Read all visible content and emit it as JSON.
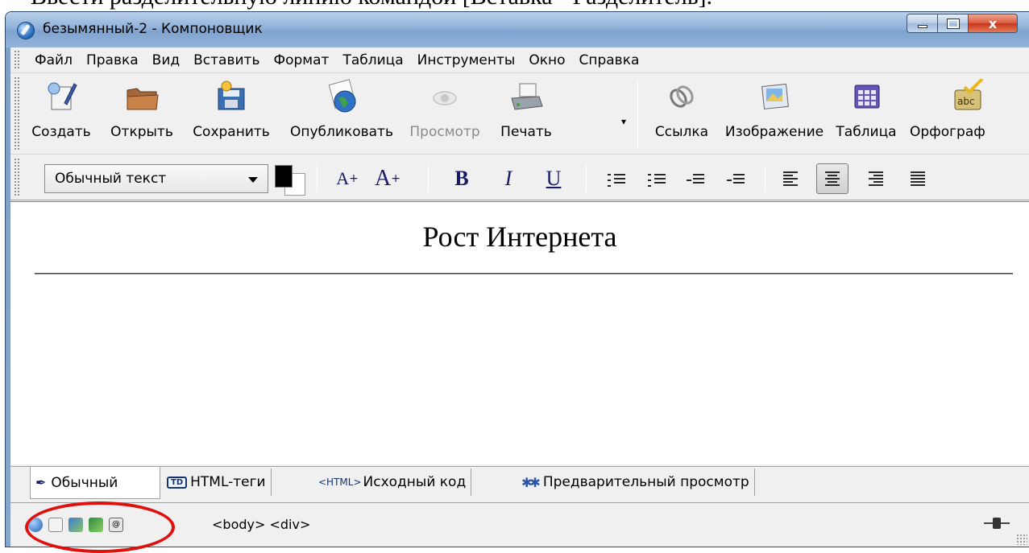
{
  "document_line": "Ввести разделительную линию командой [Вставка - Разделитель].",
  "window": {
    "title": "безымянный-2 - Компоновщик",
    "close_label": "x"
  },
  "menu": {
    "items": [
      {
        "label": "Файл"
      },
      {
        "label": "Правка"
      },
      {
        "label": "Вид"
      },
      {
        "label": "Вставить"
      },
      {
        "label": "Формат"
      },
      {
        "label": "Таблица"
      },
      {
        "label": "Инструменты"
      },
      {
        "label": "Окно"
      },
      {
        "label": "Справка"
      }
    ]
  },
  "toolbar": {
    "buttons": [
      {
        "label": "Создать",
        "icon": "new-page-icon"
      },
      {
        "label": "Открыть",
        "icon": "open-folder-icon"
      },
      {
        "label": "Сохранить",
        "icon": "save-disk-icon"
      },
      {
        "label": "Опубликовать",
        "icon": "publish-globe-icon"
      },
      {
        "label": "Просмотр",
        "icon": "preview-eye-icon",
        "disabled": true
      },
      {
        "label": "Печать",
        "icon": "printer-icon"
      },
      {
        "label": "Ссылка",
        "icon": "link-chain-icon"
      },
      {
        "label": "Изображение",
        "icon": "image-icon"
      },
      {
        "label": "Таблица",
        "icon": "table-icon"
      },
      {
        "label": "Орфограф",
        "icon": "spellcheck-icon"
      }
    ]
  },
  "format": {
    "paragraph_style": "Обычный текст",
    "bold": "B",
    "italic": "I",
    "underline": "U",
    "smaller_font": "A",
    "larger_font": "A"
  },
  "editor": {
    "heading": "Рост Интернета"
  },
  "tabs": [
    {
      "label": "Обычный",
      "active": true
    },
    {
      "badge": "TD",
      "label": "HTML-теги"
    },
    {
      "badge": "<HTML>",
      "label": "Исходный код"
    },
    {
      "label": "Предварительный просмотр"
    }
  ],
  "status": {
    "tag_path": "<body>  <div>"
  },
  "colors": {
    "highlight_ring": "#e0100e",
    "title_bar": "#8fb1d9",
    "close_button": "#d9553a"
  }
}
